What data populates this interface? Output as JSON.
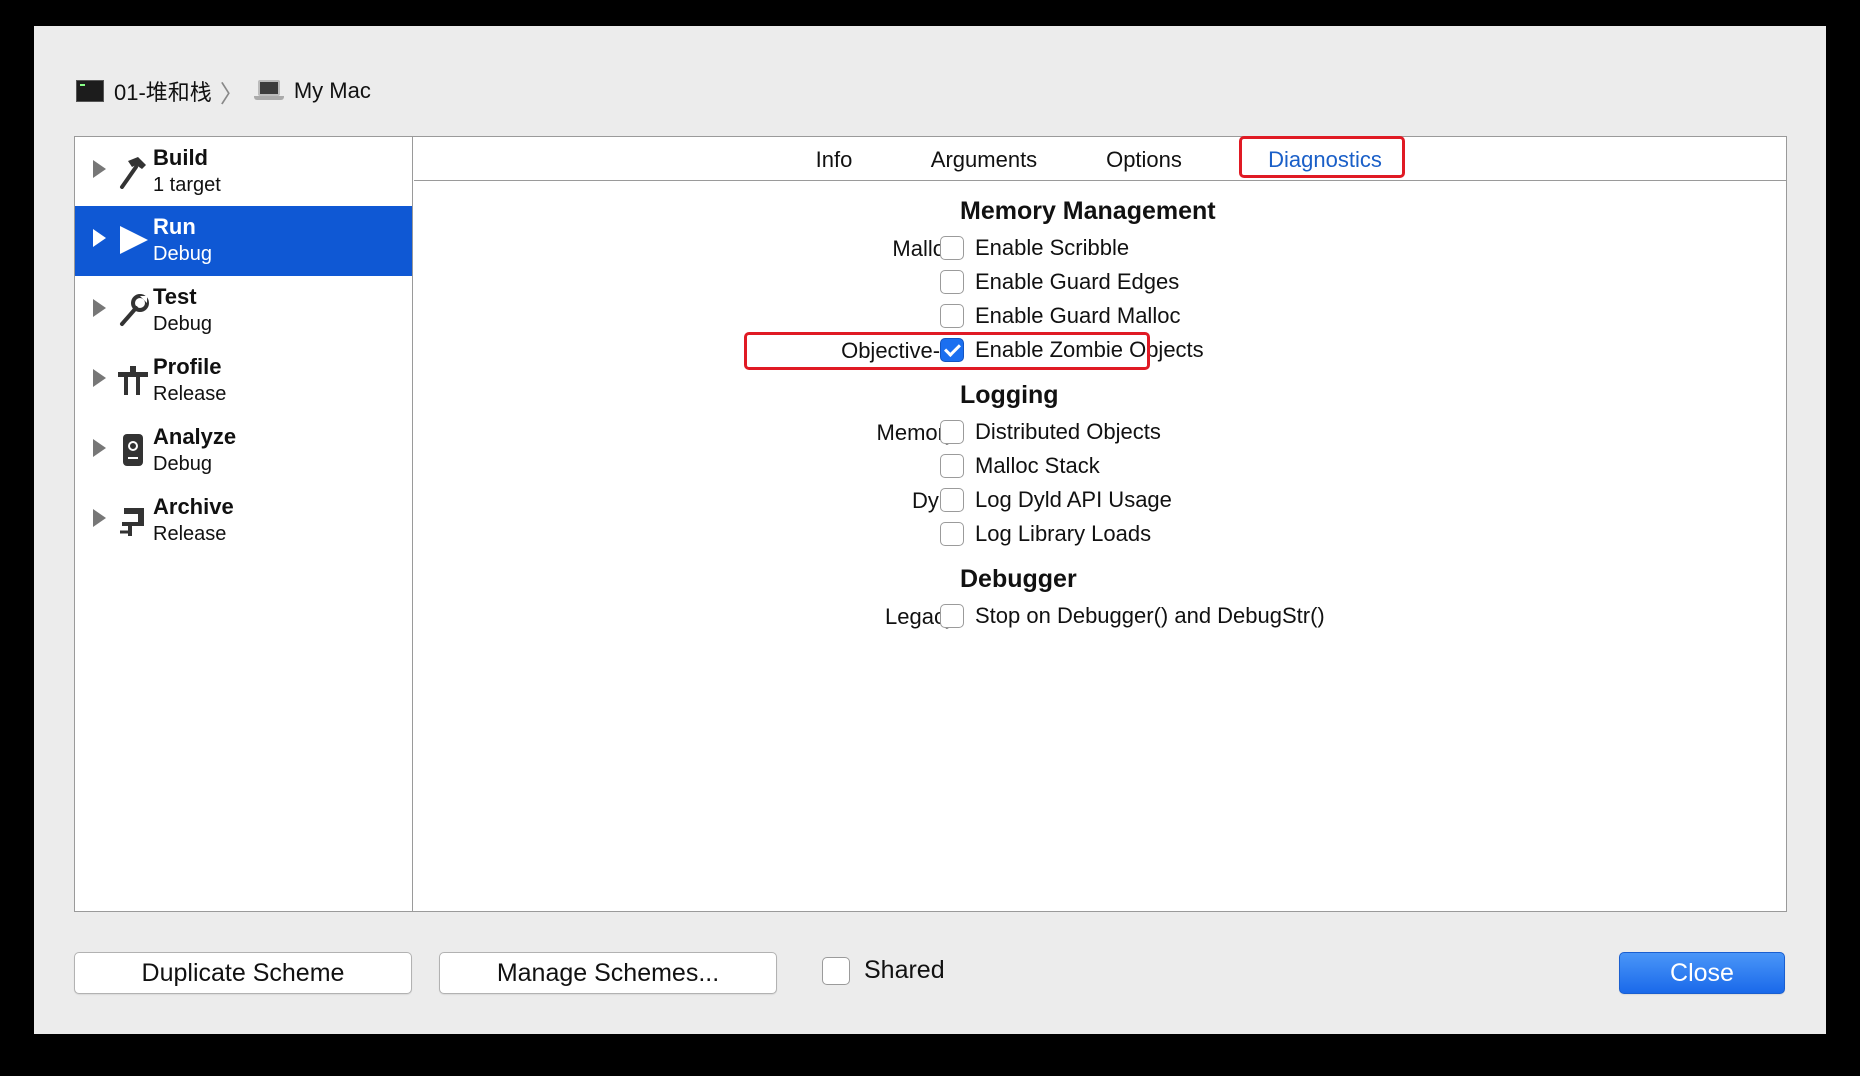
{
  "breadcrumb": {
    "project": "01-堆和栈",
    "separator": "〉",
    "destination": "My Mac"
  },
  "sidebar": {
    "items": [
      {
        "title": "Build",
        "subtitle": "1 target",
        "icon": "hammer-icon",
        "selected": false
      },
      {
        "title": "Run",
        "subtitle": "Debug",
        "icon": "play-icon",
        "selected": true
      },
      {
        "title": "Test",
        "subtitle": "Debug",
        "icon": "wrench-icon",
        "selected": false
      },
      {
        "title": "Profile",
        "subtitle": "Release",
        "icon": "gauge-icon",
        "selected": false
      },
      {
        "title": "Analyze",
        "subtitle": "Debug",
        "icon": "analyze-icon",
        "selected": false
      },
      {
        "title": "Archive",
        "subtitle": "Release",
        "icon": "archive-icon",
        "selected": false
      }
    ]
  },
  "tabs": [
    {
      "label": "Info",
      "active": false
    },
    {
      "label": "Arguments",
      "active": false
    },
    {
      "label": "Options",
      "active": false
    },
    {
      "label": "Diagnostics",
      "active": true
    }
  ],
  "diagnostics": {
    "memory_management": {
      "title": "Memory Management",
      "malloc_label": "Malloc",
      "enable_scribble": {
        "label": "Enable Scribble",
        "checked": false
      },
      "enable_guard_edges": {
        "label": "Enable Guard Edges",
        "checked": false
      },
      "enable_guard_malloc": {
        "label": "Enable Guard Malloc",
        "checked": false
      },
      "objc_label": "Objective-C",
      "enable_zombie_objects": {
        "label": "Enable Zombie Objects",
        "checked": true
      }
    },
    "logging": {
      "title": "Logging",
      "memory_label": "Memory",
      "distributed_objects": {
        "label": "Distributed Objects",
        "checked": false
      },
      "malloc_stack": {
        "label": "Malloc Stack",
        "checked": false
      },
      "dyld_label": "Dyld",
      "log_dyld_api_usage": {
        "label": "Log Dyld API Usage",
        "checked": false
      },
      "log_library_loads": {
        "label": "Log Library Loads",
        "checked": false
      }
    },
    "debugger": {
      "title": "Debugger",
      "legacy_label": "Legacy",
      "stop_on_debugger": {
        "label": "Stop on Debugger() and DebugStr()",
        "checked": false
      }
    }
  },
  "footer": {
    "duplicate_label": "Duplicate Scheme",
    "manage_label": "Manage Schemes...",
    "shared_label": "Shared",
    "shared_checked": false,
    "close_label": "Close"
  },
  "colors": {
    "selection": "#0f58d4",
    "active_tab": "#1a5fc8",
    "highlight_box": "#e01a24",
    "checkbox_checked": "#1b6ff0"
  }
}
